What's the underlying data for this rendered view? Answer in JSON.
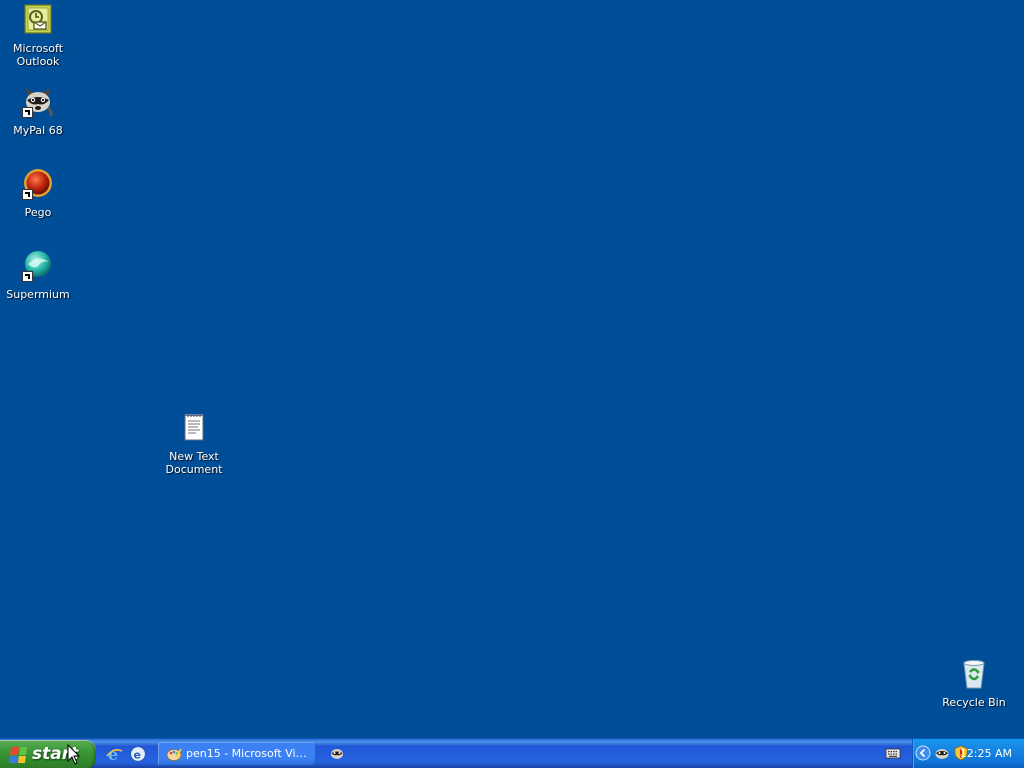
{
  "desktop": {
    "icons": [
      {
        "name": "microsoft-outlook",
        "label": "Microsoft Outlook"
      },
      {
        "name": "mypal-68",
        "label": "MyPal 68"
      },
      {
        "name": "pego",
        "label": "Pego"
      },
      {
        "name": "supermium",
        "label": "Supermium"
      },
      {
        "name": "new-text-document",
        "label": "New Text Document"
      },
      {
        "name": "recycle-bin",
        "label": "Recycle Bin"
      }
    ]
  },
  "taskbar": {
    "start_label": "start",
    "quick_launch": [
      "internet-explorer-icon",
      "outlook-express-icon"
    ],
    "buttons": [
      {
        "label": "pen15 - Microsoft Vis...",
        "icon": "paint-icon"
      }
    ],
    "tray_icons": [
      "keyboard-icon",
      "chevron-left-icon",
      "mypal-icon",
      "security-shield-icon"
    ],
    "clock": "12:25 AM"
  },
  "colors": {
    "desktop_bg": "#004e98",
    "taskbar_blue": "#2663e0",
    "start_green": "#3d9a3b"
  }
}
